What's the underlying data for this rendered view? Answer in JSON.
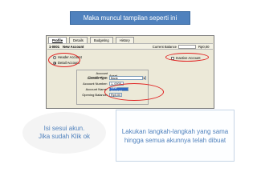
{
  "header": {
    "title": "Maka muncul tampilan seperti ini"
  },
  "screenshot": {
    "tabs": [
      "Profile",
      "Details",
      "Budgeting",
      "History"
    ],
    "account_id": "1-0001",
    "account_name": "New Account",
    "current_balance_label": "Current Balance",
    "current_balance_value": "Rp0,00",
    "header_account_label": "Header Account",
    "detail_account_label": "Detail Account",
    "inactive_account_label": "Inactive Account",
    "fields": {
      "classification_label": "Account Classification:",
      "classification_value": "Asset",
      "type_label": "Account Type:",
      "type_value": "Bank",
      "number_label": "Account Number:",
      "number_value": "1- 0005",
      "name_label": "Account Name:",
      "name_value": "New Account",
      "opening_label": "Opening Balance:",
      "opening_value": "Rp0,00"
    }
  },
  "notes": {
    "left_line1": "Isi sesui akun.",
    "left_line2": "Jika sudah Klik ok",
    "right_line1": "Lakukan langkah-langkah yang sama",
    "right_line2": "hingga semua akunnya telah dibuat"
  },
  "colors": {
    "accent": "#4f81bd",
    "highlight_circle": "#e02020"
  }
}
